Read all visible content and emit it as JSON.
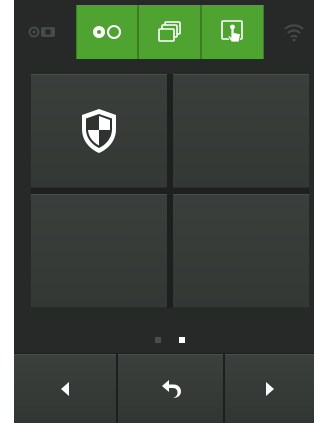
{
  "toolbar": {
    "tabs": [
      {
        "icon": "camera-icon",
        "state": "disabled"
      },
      {
        "icon": "cassette-icon",
        "state": "active"
      },
      {
        "icon": "stacked-windows-icon",
        "state": "active"
      },
      {
        "icon": "touch-screen-icon",
        "state": "active"
      },
      {
        "icon": "wifi-icon",
        "state": "disabled"
      }
    ],
    "active_color": "#4fa331"
  },
  "grid": {
    "tiles": [
      {
        "icon": "security-shield-icon"
      },
      {
        "icon": ""
      },
      {
        "icon": ""
      },
      {
        "icon": ""
      }
    ]
  },
  "pager": {
    "total_pages": 2,
    "current_page": 2
  },
  "navbar": {
    "buttons": [
      {
        "icon": "arrow-left-icon"
      },
      {
        "icon": "back-return-icon"
      },
      {
        "icon": "arrow-right-icon"
      }
    ]
  }
}
